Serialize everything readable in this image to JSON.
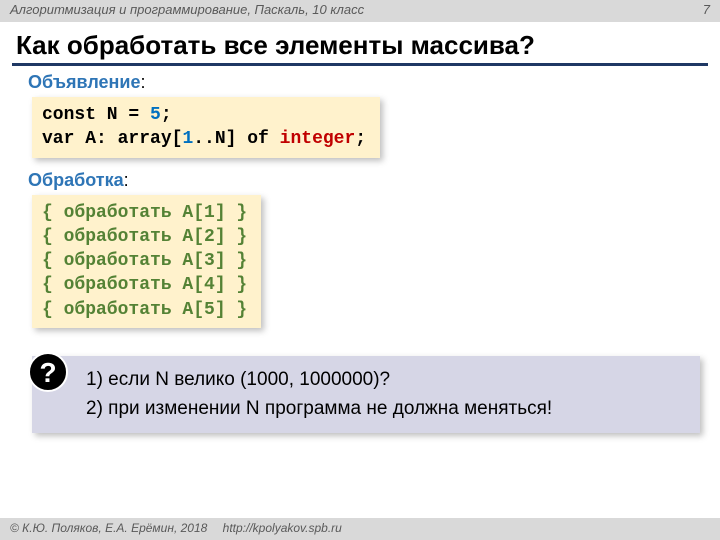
{
  "header": {
    "course": "Алгоритмизация и программирование, Паскаль, 10 класс",
    "page": "7"
  },
  "title": "Как обработать все элементы массива?",
  "sections": {
    "declare_label": "Объявление",
    "process_label": "Обработка"
  },
  "code_declare": {
    "l1_p1": "const N",
    "l1_eq": " = ",
    "l1_val": "5",
    "l1_end": ";",
    "l2_p1": "var A: array[",
    "l2_one": "1",
    "l2_mid": "..N] of ",
    "l2_type": "integer",
    "l2_end": ";"
  },
  "code_process": {
    "lines": [
      "{ обработать A[1] }",
      "{ обработать A[2] }",
      "{ обработать A[3] }",
      "{ обработать A[4] }",
      "{ обработать A[5] }"
    ]
  },
  "question": {
    "icon": "?",
    "line1": "1) если N велико (1000, 1000000)?",
    "line2": "2) при изменении N программа не должна меняться!"
  },
  "footer": {
    "copyright": "© К.Ю. Поляков, Е.А. Ерёмин, 2018",
    "url": "http://kpolyakov.spb.ru"
  }
}
